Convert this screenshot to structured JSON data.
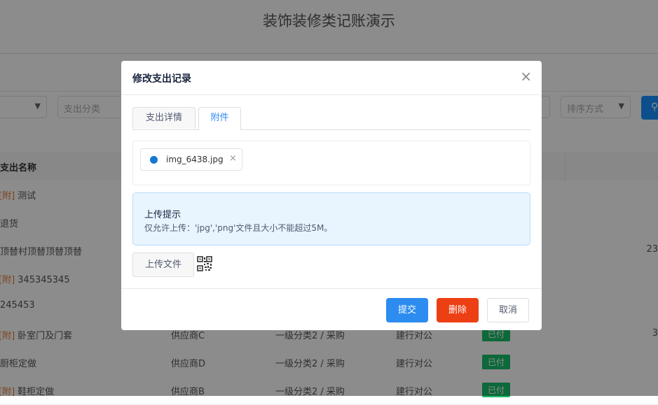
{
  "app": {
    "title": "装饰装修类记账演示"
  },
  "filters": {
    "category_placeholder": "支出分类",
    "sort_placeholder": "排序方式"
  },
  "table": {
    "header": {
      "name": "支出名称"
    },
    "attach_tag": "[附]",
    "rows": [
      {
        "tag": "[附]",
        "name": "测试"
      },
      {
        "tag": "",
        "name": "退货"
      },
      {
        "tag": "",
        "name": "顶替村顶替顶替顶替",
        "amount": "23"
      },
      {
        "tag": "[附]",
        "name": "345345345"
      },
      {
        "tag": "",
        "name": "245453"
      },
      {
        "tag": "[附]",
        "name": "卧室门及门套",
        "supplier": "供应商C",
        "category": "一级分类2 / 采购",
        "account": "建行对公",
        "status": "已付",
        "amount": "3"
      },
      {
        "tag": "",
        "name": "厨柜定做",
        "supplier": "供应商D",
        "category": "一级分类2 / 采购",
        "account": "建行对公",
        "status": "已付"
      },
      {
        "tag": "[附]",
        "name": "鞋柜定做",
        "supplier": "供应商B",
        "category": "一级分类2 / 采购",
        "account": "建行对公",
        "status": "已付"
      }
    ]
  },
  "modal": {
    "title": "修改支出记录",
    "tabs": [
      {
        "label": "支出详情"
      },
      {
        "label": "附件"
      }
    ],
    "active_tab": "附件",
    "file": {
      "name": "img_6438.jpg",
      "remove_glyph": "×"
    },
    "notice": {
      "title": "上传提示",
      "body": "仅允许上传：'jpg','png'文件且大小不能超过5M。"
    },
    "upload_label": "上传文件",
    "buttons": {
      "submit": "提交",
      "delete": "删除",
      "cancel": "取消"
    },
    "close_glyph": "×"
  },
  "colors": {
    "primary": "#2d8cf0",
    "danger": "#ed3f14",
    "success": "#19be6b",
    "attach_tag": "#e6772e"
  },
  "icons": {
    "search": "search-icon",
    "qr": "qr-code-icon",
    "close": "close-icon"
  }
}
